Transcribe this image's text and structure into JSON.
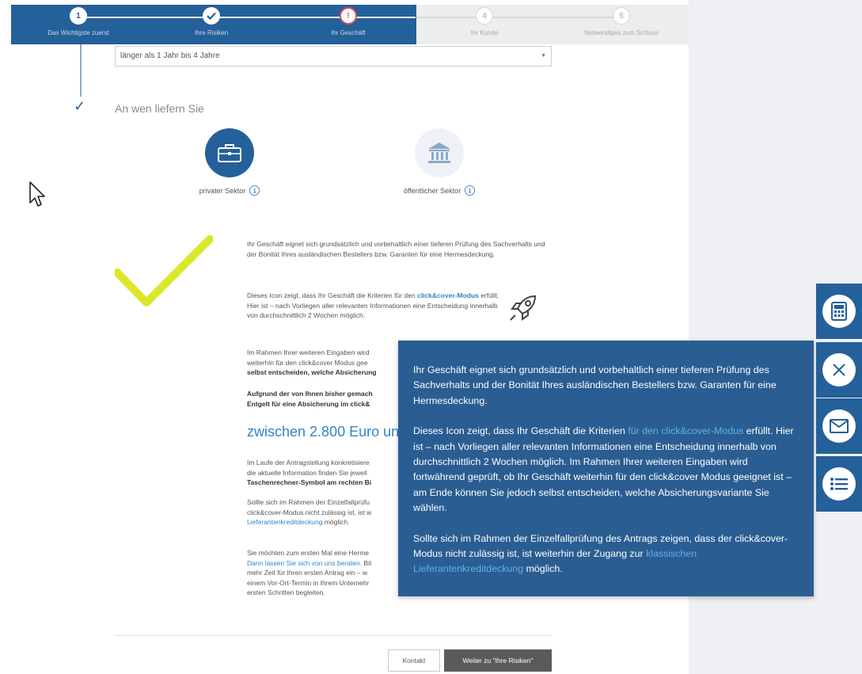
{
  "stepper": {
    "steps": [
      {
        "num": "1",
        "label": "Das Wichtigste zuerst",
        "state": "done"
      },
      {
        "num": "",
        "label": "Ihre Risiken",
        "state": "done"
      },
      {
        "num": "!",
        "label": "Ihr Geschäft",
        "state": "current"
      },
      {
        "num": "4",
        "label": "Ihr Kunde",
        "state": "todo"
      },
      {
        "num": "5",
        "label": "Notwendiges zum Schluss",
        "state": "todo"
      }
    ],
    "colors": {
      "active_bg": "#24609a",
      "inactive_bg": "#eceeee",
      "current_marker": "#e04a5a"
    }
  },
  "duration_select": {
    "value": "länger als 1 Jahr bis 4 Jahre"
  },
  "question": {
    "title": "An wen liefern Sie"
  },
  "sectors": [
    {
      "label": "privater Sektor",
      "icon": "briefcase-icon",
      "selected": true
    },
    {
      "label": "öffentlicher Sektor",
      "icon": "bank-building-icon",
      "selected": false
    }
  ],
  "result": {
    "p1": "Ihr Geschäft eignet sich grundsätzlich und vorbehaltlich einer tieferen Prüfung des Sachverhalts und der Bonität Ihres ausländischen Bestellers bzw. Garanten für eine Hermesdeckung.",
    "p2_pre": "Dieses Icon zeigt, dass Ihr Geschäft die Kriterien für den ",
    "p2_link": "click&cover-Modus",
    "p2_post": " erfüllt. Hier ist – nach Vorliegen aller relevanten Informationen eine Entscheidung innerhalb von durchschnittlich 2 Wochen möglich.",
    "p3_pre": "Im Rahmen Ihrer weiteren Eingaben wird",
    "p3_mid": "weiterhin für den click&cover Modus gee",
    "p3_bold": "selbst entscheiden, welche Absicherung",
    "p4_line1": "Aufgrund der von Ihnen bisher gemach",
    "p4_line2": "Entgelt für eine Absicherung im click&",
    "price": "zwischen 2.800 Euro und",
    "p5_line1": "Im Laufe der Antragstellung konkretisiere",
    "p5_line2": "die aktuelle Information finden Sie jeweil",
    "p5_bold": "Taschenrechner-Symbol am rechten Bi",
    "p6_line1": "Sollte sich im Rahmen der Einzelfallprüfu",
    "p6_line2": "click&cover-Modus nicht zulässig ist, ist w",
    "p6_link": "Lieferantenkreditdeckung",
    "p6_post": " möglich.",
    "p7_line1": "Sie möchten zum ersten Mal eine Herme",
    "p7_link": "Dann lassen Sie sich von uns beraten.",
    "p7_after_link": " Bit",
    "p7_line3": "mehr Zeit für Ihren ersten Antrag ein – w",
    "p7_line4": "einem Vor-Ort-Termin in Ihrem Unternehr",
    "p7_line5": "ersten Schritten begleiten."
  },
  "popover": {
    "p1": "Ihr Geschäft eignet sich grundsätzlich und vorbehaltlich einer tieferen Prüfung des Sachverhalts und der Bonität Ihres ausländischen Bestellers bzw. Garanten für eine Hermesdeckung.",
    "p2_pre": "Dieses Icon zeigt, dass Ihr Geschäft die Kriterien ",
    "p2_link": "für den click&cover-Modus",
    "p2_post": " erfüllt. Hier ist – nach Vorliegen aller relevanten Informationen eine Entscheidung innerhalb von durchschnittlich 2 Wochen möglich. Im Rahmen Ihrer weiteren Eingaben wird fortwährend geprüft, ob Ihr Geschäft weiterhin für den click&cover Modus geeignet ist – am Ende können Sie jedoch selbst entscheiden, welche Absicherungsvariante Sie wählen.",
    "p3_pre": "Sollte sich im Rahmen der Einzelfallprüfung des Antrags zeigen, dass der click&cover-Modus nicht zulässig ist, ist weiterhin der Zugang zur ",
    "p3_link": "klassischen Lieferantenkreditdeckung",
    "p3_post": " möglich."
  },
  "side_tools": [
    {
      "icon": "calculator-icon"
    },
    {
      "icon": "close-icon"
    },
    {
      "icon": "mail-icon"
    },
    {
      "icon": "list-icon"
    }
  ],
  "footer": {
    "contact_label": "Kontakt",
    "next_label": "Weiter zu \"Ihre Risiken\""
  }
}
